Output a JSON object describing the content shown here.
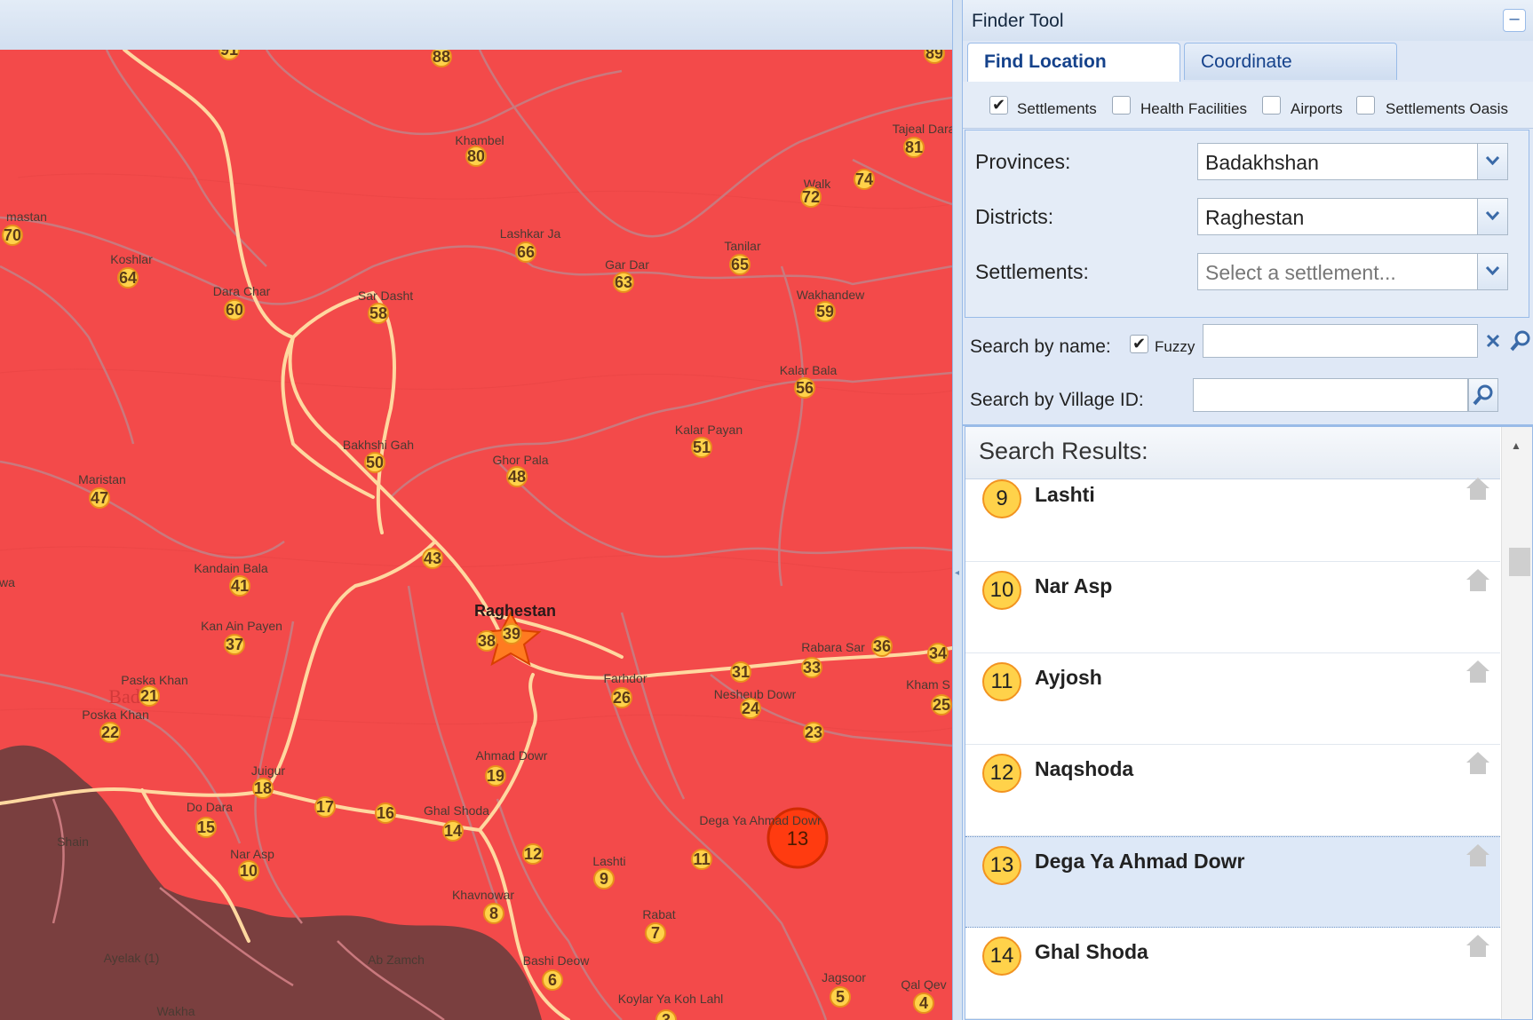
{
  "finder": {
    "title": "Finder Tool",
    "collapse_label": "–",
    "tabs": [
      {
        "label": "Find Location",
        "active": true
      },
      {
        "label": "Coordinate",
        "active": false
      }
    ],
    "layers": [
      {
        "label": "Settlements",
        "checked": true
      },
      {
        "label": "Health Facilities",
        "checked": false
      },
      {
        "label": "Airports",
        "checked": false
      },
      {
        "label": "Settlements Oasis",
        "checked": false
      }
    ],
    "filters": {
      "provinces_label": "Provinces:",
      "provinces_value": "Badakhshan",
      "districts_label": "Districts:",
      "districts_value": "Raghestan",
      "settlements_label": "Settlements:",
      "settlements_placeholder": "Select a settlement..."
    },
    "search": {
      "by_name_label": "Search by name:",
      "fuzzy_label": "Fuzzy",
      "fuzzy_checked": true,
      "name_value": "",
      "by_id_label": "Search by Village ID:",
      "id_value": ""
    },
    "results_title": "Search Results:",
    "results": [
      {
        "num": "9",
        "name": "Lashti",
        "selected": false
      },
      {
        "num": "10",
        "name": "Nar Asp",
        "selected": false
      },
      {
        "num": "11",
        "name": "Ayjosh",
        "selected": false
      },
      {
        "num": "12",
        "name": "Naqshoda",
        "selected": false
      },
      {
        "num": "13",
        "name": "Dega Ya Ahmad Dowr",
        "selected": true
      },
      {
        "num": "14",
        "name": "Ghal Shoda",
        "selected": false
      }
    ]
  },
  "map": {
    "colors": {
      "district": "#f34a4a",
      "outside": "#7a3f3f",
      "road": "#ffd8a0",
      "track": "#c9797e",
      "marker": "#ffd24a",
      "highlight": "#ff3b10"
    },
    "place_labels": [
      "Khambel",
      "Tajeal Dara",
      "Walk",
      "Lashkar Ja",
      "Gar Dar",
      "Tanilar",
      "Wakhandew",
      "Koshlar",
      "Dara Char",
      "Sar Dasht",
      "Kalar Bala",
      "Kalar Payan",
      "Bakhshi Gah",
      "Ghor Pala",
      "Maristan",
      "Kandain Bala",
      "Kan Ain Payen",
      "Paska Khan",
      "Poska Khan",
      "Raghestan",
      "Rabara Sar",
      "Farhdor",
      "Nesheub Dowr",
      "Kham S",
      "Ahmad Dowr",
      "Juigur",
      "Do Dara",
      "Ghal Shoda",
      "Dega Ya Ahmad Dowr",
      "Nar Asp",
      "Lashti",
      "Khavnowar",
      "Rabat",
      "Bashi Deow",
      "Jagsoor",
      "Qal Qev",
      "Koylar Ya Koh Lahl",
      "Ayelak (1)",
      "Ab Zamch",
      "Shain",
      "Wakha",
      "mastan",
      "wa",
      "Bad"
    ],
    "markers": [
      "91",
      "88",
      "89",
      "80",
      "81",
      "74",
      "72",
      "70",
      "66",
      "65",
      "63",
      "64",
      "60",
      "58",
      "59",
      "56",
      "51",
      "50",
      "48",
      "47",
      "43",
      "41",
      "39",
      "38",
      "37",
      "36",
      "34",
      "33",
      "31",
      "26",
      "25",
      "24",
      "23",
      "21",
      "22",
      "19",
      "18",
      "17",
      "16",
      "15",
      "14",
      "12",
      "11",
      "10",
      "9",
      "8",
      "7",
      "6",
      "5",
      "4",
      "3"
    ],
    "highlighted_marker": "13"
  }
}
